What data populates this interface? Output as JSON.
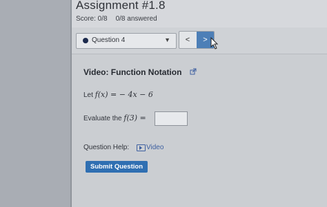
{
  "assignment": {
    "title": "Assignment #1.8",
    "score": "Score: 0/8",
    "answered": "0/8 answered"
  },
  "nav": {
    "question_label": "Question 4",
    "prev": "<",
    "next": ">"
  },
  "question": {
    "video_title": "Video: Function Notation",
    "let_prefix": "Let",
    "function_text": "f(x) = − 4x − 6",
    "eval_prefix": "Evaluate the",
    "eval_expr": "f(3) ="
  },
  "help": {
    "label": "Question Help:",
    "video_link": "Video"
  },
  "submit": {
    "label": "Submit Question"
  },
  "colors": {
    "accent": "#2f6fb2",
    "link": "#3d5fa0"
  }
}
